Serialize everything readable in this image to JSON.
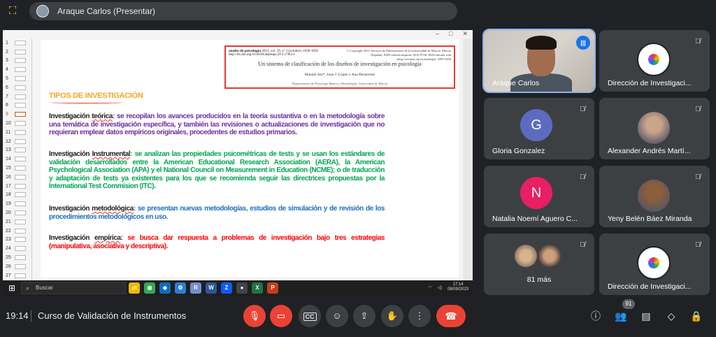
{
  "presenter": {
    "name": "Araque Carlos (Presentar)"
  },
  "slide_panel": {
    "thumb_numbers": [
      "1",
      "2",
      "3",
      "4",
      "5",
      "6",
      "7",
      "8",
      "9",
      "10",
      "11",
      "12",
      "13",
      "14",
      "15",
      "16",
      "17",
      "18",
      "19",
      "20",
      "21",
      "22",
      "23",
      "24",
      "25",
      "26",
      "27"
    ],
    "selected_index": 8
  },
  "slide": {
    "ref": {
      "journal": "anales de psicología",
      "journal_info": "2013, vol. 29, nº 3 (octubre), 1038-1059",
      "doi": "http://dx.doi.org/10.6018/analesps.29.3.178511",
      "right_info": "© Copyright 2013: Servicio de Publicaciones de la Universidad de Murcia. Murcia (España). ISSN edición impresa: 0212-9728. ISSN edición web (http://revistas.um.es/analesps): 1695-2294",
      "title": "Un sistema de clasificación de los diseños de investigación en psicología",
      "authors": "Manuel Ato*, Juan J. López y Ana Benavente",
      "dept": "Departamento de Psicología Básica y Metodología, Universidad de Murcia"
    },
    "heading": "TIPOS DE INVESTIGACIÓN",
    "paragraphs": [
      {
        "term_a": "Investigación ",
        "term_b": "teórica",
        "text": ": se recopilan los avances producidos en la teoría sustantiva o en la metodología sobre una temática de investigación específica, y también las revisiones o actualizaciones de investigación que no requieran emplear datos empíricos originales, procedentes de estudios primarios."
      },
      {
        "term_a": "Investigación ",
        "term_b": "Instrumental",
        "text": ": se analizan las propiedades psicométricas de tests y se usan los estándares de validación desarrollados entre la American Educational Research Association (AERA), la American Psychological Association (APA) y el National Council on Measurement in Education (NCME); o de traducción y adaptación de tests ya existentes para los que se recomienda seguir las directrices propuestas por la International Test Commision (ITC)."
      },
      {
        "term_a": "Investigación ",
        "term_b": "metodológica",
        "text": ": se presentan nuevas metodologías, estudios de simulación y de revisión de los procedimientos metodológicos en uso."
      },
      {
        "term_a": "Investigación ",
        "term_b": "empírica",
        "text": ": se busca dar respuesta a problemas de investigación bajo tres estrategias (manipulativa, asociativa y descriptiva)."
      }
    ]
  },
  "taskbar": {
    "search_placeholder": "Buscar",
    "time": "17:14",
    "date": "08/09/2023",
    "apps": [
      {
        "label": "📁",
        "color": "#f2b600"
      },
      {
        "label": "◉",
        "color": "#34a853"
      },
      {
        "label": "◆",
        "color": "#0f6cbd"
      },
      {
        "label": "⚙",
        "color": "#2a7fd4"
      },
      {
        "label": "R",
        "color": "#6f8fd0"
      },
      {
        "label": "W",
        "color": "#2b579a"
      },
      {
        "label": "Z",
        "color": "#0b5cff"
      },
      {
        "label": "●",
        "color": "#444444"
      },
      {
        "label": "X",
        "color": "#217346"
      },
      {
        "label": "P",
        "color": "#c43e1c"
      }
    ]
  },
  "participants": [
    {
      "name": "Araque Carlos",
      "kind": "video",
      "speaking": true
    },
    {
      "name": "Dirección de Investigaci...",
      "kind": "logo"
    },
    {
      "name": "Gloria Gonzalez",
      "kind": "letter",
      "letter": "G",
      "color": "#5c6bc0"
    },
    {
      "name": "Alexander Andrés Martí...",
      "kind": "photo",
      "color": "#c9a58a"
    },
    {
      "name": "Natalia Noemí Aguero C...",
      "kind": "letter",
      "letter": "N",
      "color": "#e91e63"
    },
    {
      "name": "Yeny Belén Báez Miranda",
      "kind": "photo",
      "color": "#8b5e3c"
    },
    {
      "name": "81 más",
      "kind": "more"
    },
    {
      "name": "Dirección de Investigaci...",
      "kind": "logo"
    }
  ],
  "bottom": {
    "time": "19:14",
    "meeting_title": "Curso de Validación de Instrumentos",
    "participant_count": "91"
  },
  "colors": {
    "accent": "#1a73e8",
    "danger": "#ea4335",
    "tile": "#3c4043",
    "bg": "#202124"
  }
}
